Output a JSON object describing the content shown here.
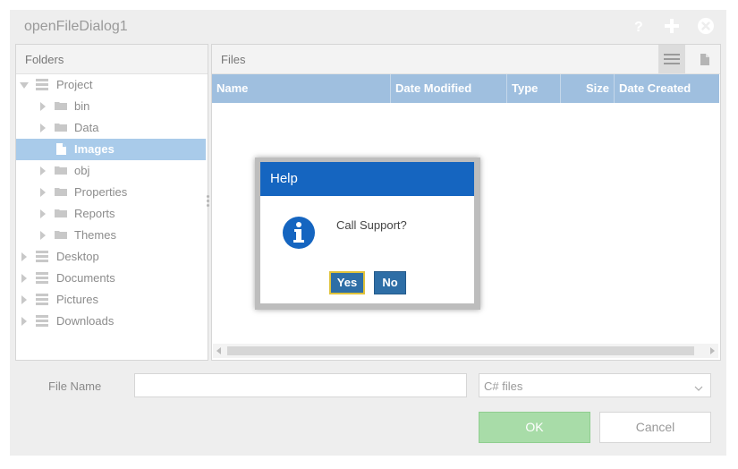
{
  "window": {
    "title": "openFileDialog1"
  },
  "folders": {
    "header": "Folders",
    "items": [
      {
        "label": "Project",
        "icon": "drive-icon",
        "expanded": true
      },
      {
        "label": "bin",
        "icon": "folder-icon"
      },
      {
        "label": "Data",
        "icon": "folder-icon"
      },
      {
        "label": "Images",
        "icon": "file-icon",
        "selected": true
      },
      {
        "label": "obj",
        "icon": "folder-icon"
      },
      {
        "label": "Properties",
        "icon": "folder-icon"
      },
      {
        "label": "Reports",
        "icon": "folder-icon"
      },
      {
        "label": "Themes",
        "icon": "folder-icon"
      },
      {
        "label": "Desktop",
        "icon": "drive-icon"
      },
      {
        "label": "Documents",
        "icon": "drive-icon"
      },
      {
        "label": "Pictures",
        "icon": "drive-icon"
      },
      {
        "label": "Downloads",
        "icon": "drive-icon"
      }
    ]
  },
  "files": {
    "header": "Files",
    "columns": [
      "Name",
      "Date Modified",
      "Type",
      "Size",
      "Date Created"
    ]
  },
  "footer": {
    "file_name_label": "File Name",
    "file_name_value": "",
    "filter_value": "C# files",
    "ok_label": "OK",
    "cancel_label": "Cancel"
  },
  "messagebox": {
    "title": "Help",
    "text": "Call Support?",
    "yes_label": "Yes",
    "no_label": "No",
    "icon": "info-icon"
  },
  "colors": {
    "accent": "#1565c0",
    "grid_header": "#9fbfdf",
    "selection": "#a9cbea",
    "ok_button": "#a8dca8"
  }
}
